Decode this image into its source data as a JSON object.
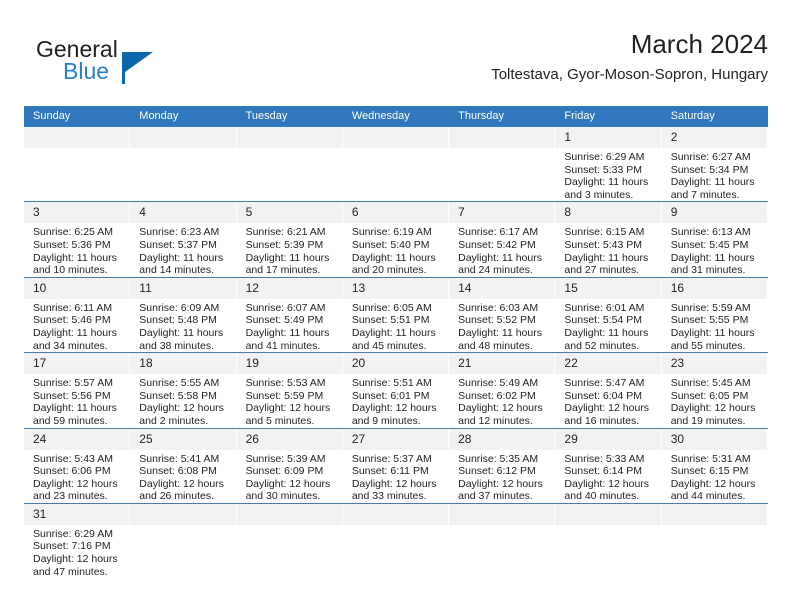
{
  "brand": {
    "name_top": "General",
    "name_bottom": "Blue",
    "logo_icon": "triangle-icon",
    "color_top": "#231f20",
    "color_bottom": "#2a7fc9",
    "accent": "#0b66ab"
  },
  "header": {
    "title": "March 2024",
    "subtitle": "Toltestava, Gyor-Moson-Sopron, Hungary"
  },
  "theme": {
    "header_blue": "#3077bd",
    "row_divider": "#4a7ca8",
    "daynum_bg": "#f2f2f2",
    "text": "#231f20"
  },
  "calendar": {
    "weekday_headers": [
      "Sunday",
      "Monday",
      "Tuesday",
      "Wednesday",
      "Thursday",
      "Friday",
      "Saturday"
    ],
    "weeks": [
      [
        {
          "day": "",
          "empty": true
        },
        {
          "day": "",
          "empty": true
        },
        {
          "day": "",
          "empty": true
        },
        {
          "day": "",
          "empty": true
        },
        {
          "day": "",
          "empty": true
        },
        {
          "day": "1",
          "sunrise": "Sunrise: 6:29 AM",
          "sunset": "Sunset: 5:33 PM",
          "daylight1": "Daylight: 11 hours",
          "daylight2": "and 3 minutes."
        },
        {
          "day": "2",
          "sunrise": "Sunrise: 6:27 AM",
          "sunset": "Sunset: 5:34 PM",
          "daylight1": "Daylight: 11 hours",
          "daylight2": "and 7 minutes."
        }
      ],
      [
        {
          "day": "3",
          "sunrise": "Sunrise: 6:25 AM",
          "sunset": "Sunset: 5:36 PM",
          "daylight1": "Daylight: 11 hours",
          "daylight2": "and 10 minutes."
        },
        {
          "day": "4",
          "sunrise": "Sunrise: 6:23 AM",
          "sunset": "Sunset: 5:37 PM",
          "daylight1": "Daylight: 11 hours",
          "daylight2": "and 14 minutes."
        },
        {
          "day": "5",
          "sunrise": "Sunrise: 6:21 AM",
          "sunset": "Sunset: 5:39 PM",
          "daylight1": "Daylight: 11 hours",
          "daylight2": "and 17 minutes."
        },
        {
          "day": "6",
          "sunrise": "Sunrise: 6:19 AM",
          "sunset": "Sunset: 5:40 PM",
          "daylight1": "Daylight: 11 hours",
          "daylight2": "and 20 minutes."
        },
        {
          "day": "7",
          "sunrise": "Sunrise: 6:17 AM",
          "sunset": "Sunset: 5:42 PM",
          "daylight1": "Daylight: 11 hours",
          "daylight2": "and 24 minutes."
        },
        {
          "day": "8",
          "sunrise": "Sunrise: 6:15 AM",
          "sunset": "Sunset: 5:43 PM",
          "daylight1": "Daylight: 11 hours",
          "daylight2": "and 27 minutes."
        },
        {
          "day": "9",
          "sunrise": "Sunrise: 6:13 AM",
          "sunset": "Sunset: 5:45 PM",
          "daylight1": "Daylight: 11 hours",
          "daylight2": "and 31 minutes."
        }
      ],
      [
        {
          "day": "10",
          "sunrise": "Sunrise: 6:11 AM",
          "sunset": "Sunset: 5:46 PM",
          "daylight1": "Daylight: 11 hours",
          "daylight2": "and 34 minutes."
        },
        {
          "day": "11",
          "sunrise": "Sunrise: 6:09 AM",
          "sunset": "Sunset: 5:48 PM",
          "daylight1": "Daylight: 11 hours",
          "daylight2": "and 38 minutes."
        },
        {
          "day": "12",
          "sunrise": "Sunrise: 6:07 AM",
          "sunset": "Sunset: 5:49 PM",
          "daylight1": "Daylight: 11 hours",
          "daylight2": "and 41 minutes."
        },
        {
          "day": "13",
          "sunrise": "Sunrise: 6:05 AM",
          "sunset": "Sunset: 5:51 PM",
          "daylight1": "Daylight: 11 hours",
          "daylight2": "and 45 minutes."
        },
        {
          "day": "14",
          "sunrise": "Sunrise: 6:03 AM",
          "sunset": "Sunset: 5:52 PM",
          "daylight1": "Daylight: 11 hours",
          "daylight2": "and 48 minutes."
        },
        {
          "day": "15",
          "sunrise": "Sunrise: 6:01 AM",
          "sunset": "Sunset: 5:54 PM",
          "daylight1": "Daylight: 11 hours",
          "daylight2": "and 52 minutes."
        },
        {
          "day": "16",
          "sunrise": "Sunrise: 5:59 AM",
          "sunset": "Sunset: 5:55 PM",
          "daylight1": "Daylight: 11 hours",
          "daylight2": "and 55 minutes."
        }
      ],
      [
        {
          "day": "17",
          "sunrise": "Sunrise: 5:57 AM",
          "sunset": "Sunset: 5:56 PM",
          "daylight1": "Daylight: 11 hours",
          "daylight2": "and 59 minutes."
        },
        {
          "day": "18",
          "sunrise": "Sunrise: 5:55 AM",
          "sunset": "Sunset: 5:58 PM",
          "daylight1": "Daylight: 12 hours",
          "daylight2": "and 2 minutes."
        },
        {
          "day": "19",
          "sunrise": "Sunrise: 5:53 AM",
          "sunset": "Sunset: 5:59 PM",
          "daylight1": "Daylight: 12 hours",
          "daylight2": "and 5 minutes."
        },
        {
          "day": "20",
          "sunrise": "Sunrise: 5:51 AM",
          "sunset": "Sunset: 6:01 PM",
          "daylight1": "Daylight: 12 hours",
          "daylight2": "and 9 minutes."
        },
        {
          "day": "21",
          "sunrise": "Sunrise: 5:49 AM",
          "sunset": "Sunset: 6:02 PM",
          "daylight1": "Daylight: 12 hours",
          "daylight2": "and 12 minutes."
        },
        {
          "day": "22",
          "sunrise": "Sunrise: 5:47 AM",
          "sunset": "Sunset: 6:04 PM",
          "daylight1": "Daylight: 12 hours",
          "daylight2": "and 16 minutes."
        },
        {
          "day": "23",
          "sunrise": "Sunrise: 5:45 AM",
          "sunset": "Sunset: 6:05 PM",
          "daylight1": "Daylight: 12 hours",
          "daylight2": "and 19 minutes."
        }
      ],
      [
        {
          "day": "24",
          "sunrise": "Sunrise: 5:43 AM",
          "sunset": "Sunset: 6:06 PM",
          "daylight1": "Daylight: 12 hours",
          "daylight2": "and 23 minutes."
        },
        {
          "day": "25",
          "sunrise": "Sunrise: 5:41 AM",
          "sunset": "Sunset: 6:08 PM",
          "daylight1": "Daylight: 12 hours",
          "daylight2": "and 26 minutes."
        },
        {
          "day": "26",
          "sunrise": "Sunrise: 5:39 AM",
          "sunset": "Sunset: 6:09 PM",
          "daylight1": "Daylight: 12 hours",
          "daylight2": "and 30 minutes."
        },
        {
          "day": "27",
          "sunrise": "Sunrise: 5:37 AM",
          "sunset": "Sunset: 6:11 PM",
          "daylight1": "Daylight: 12 hours",
          "daylight2": "and 33 minutes."
        },
        {
          "day": "28",
          "sunrise": "Sunrise: 5:35 AM",
          "sunset": "Sunset: 6:12 PM",
          "daylight1": "Daylight: 12 hours",
          "daylight2": "and 37 minutes."
        },
        {
          "day": "29",
          "sunrise": "Sunrise: 5:33 AM",
          "sunset": "Sunset: 6:14 PM",
          "daylight1": "Daylight: 12 hours",
          "daylight2": "and 40 minutes."
        },
        {
          "day": "30",
          "sunrise": "Sunrise: 5:31 AM",
          "sunset": "Sunset: 6:15 PM",
          "daylight1": "Daylight: 12 hours",
          "daylight2": "and 44 minutes."
        }
      ],
      [
        {
          "day": "31",
          "sunrise": "Sunrise: 6:29 AM",
          "sunset": "Sunset: 7:16 PM",
          "daylight1": "Daylight: 12 hours",
          "daylight2": "and 47 minutes."
        },
        {
          "day": "",
          "empty": true
        },
        {
          "day": "",
          "empty": true
        },
        {
          "day": "",
          "empty": true
        },
        {
          "day": "",
          "empty": true
        },
        {
          "day": "",
          "empty": true
        },
        {
          "day": "",
          "empty": true
        }
      ]
    ]
  }
}
